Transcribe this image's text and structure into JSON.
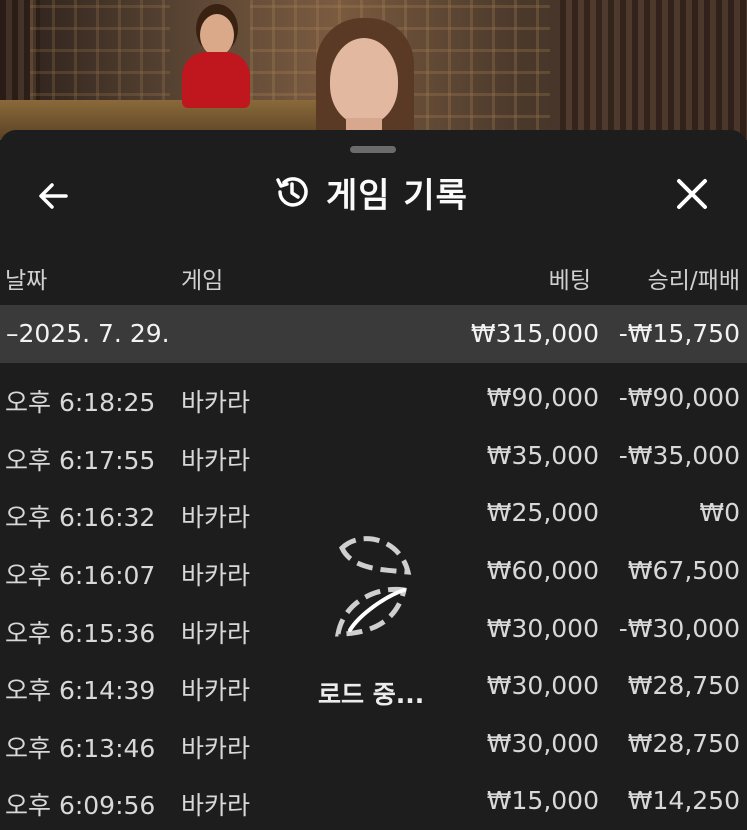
{
  "header": {
    "title": "게임 기록",
    "back_icon": "arrow-left-icon",
    "history_icon": "history-clock-icon",
    "close_icon": "close-icon"
  },
  "columns": {
    "date": "날짜",
    "game": "게임",
    "bet": "베팅",
    "result": "승리/패배"
  },
  "date_group": {
    "date": "–2025. 7. 29.",
    "total_bet": "₩315,000",
    "total_result": "-₩15,750"
  },
  "rows": [
    {
      "time": "오후 6:18:25",
      "game": "바카라",
      "bet": "₩90,000",
      "result": "-₩90,000"
    },
    {
      "time": "오후 6:17:55",
      "game": "바카라",
      "bet": "₩35,000",
      "result": "-₩35,000"
    },
    {
      "time": "오후 6:16:32",
      "game": "바카라",
      "bet": "₩25,000",
      "result": "₩0"
    },
    {
      "time": "오후 6:16:07",
      "game": "바카라",
      "bet": "₩60,000",
      "result": "₩67,500"
    },
    {
      "time": "오후 6:15:36",
      "game": "바카라",
      "bet": "₩30,000",
      "result": "-₩30,000"
    },
    {
      "time": "오후 6:14:39",
      "game": "바카라",
      "bet": "₩30,000",
      "result": "₩28,750"
    },
    {
      "time": "오후 6:13:46",
      "game": "바카라",
      "bet": "₩30,000",
      "result": "₩28,750"
    },
    {
      "time": "오후 6:09:56",
      "game": "바카라",
      "bet": "₩15,000",
      "result": "₩14,250"
    }
  ],
  "loading": {
    "text": "로드 중...",
    "icon": "spinner-icon"
  }
}
